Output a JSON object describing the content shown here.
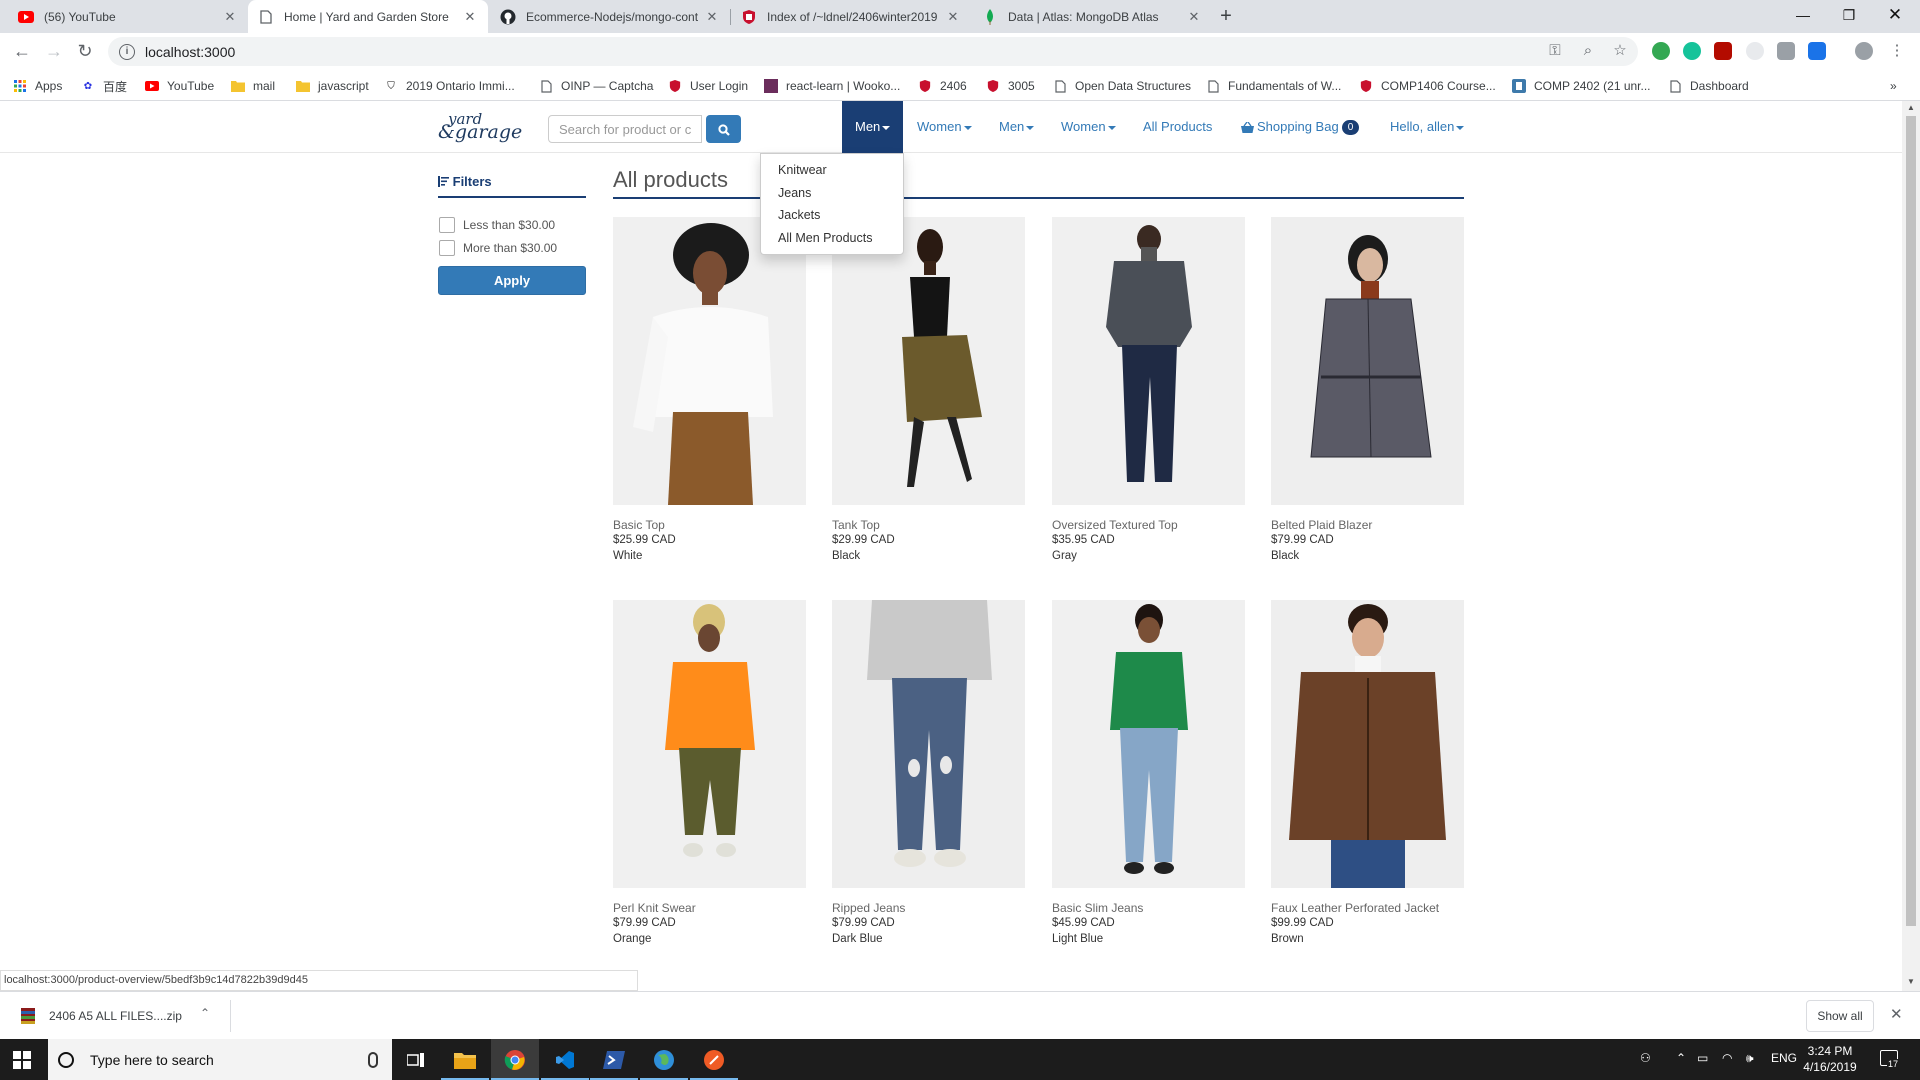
{
  "browser": {
    "tabs": [
      {
        "title": "(56) YouTube",
        "icon": "youtube-icon"
      },
      {
        "title": "Home | Yard and Garden Store",
        "icon": "page-icon",
        "active": true
      },
      {
        "title": "Ecommerce-Nodejs/mongo-cont",
        "icon": "github-icon"
      },
      {
        "title": "Index of /~ldnel/2406winter2019",
        "icon": "shield-icon"
      },
      {
        "title": "Data | Atlas: MongoDB Atlas",
        "icon": "leaf-icon"
      }
    ],
    "url": "localhost:3000",
    "bookmarks": [
      "Apps",
      "百度",
      "YouTube",
      "mail",
      "javascript",
      "2019 Ontario Immi...",
      "OINP — Captcha",
      "User Login",
      "react-learn | Wooko...",
      "2406",
      "3005",
      "Open Data Structures",
      "Fundamentals of W...",
      "COMP1406 Course...",
      "COMP 2402 (21 unr...",
      "Dashboard"
    ]
  },
  "site": {
    "logo_line1": "yard",
    "logo_line2": "&garage",
    "search_placeholder": "Search for product or c",
    "nav": {
      "men_open": "Men",
      "women1": "Women",
      "men2": "Men",
      "women2": "Women",
      "all_products": "All Products",
      "bag_label": "Shopping Bag",
      "bag_count": "0",
      "greeting": "Hello, allen"
    },
    "men_dropdown": [
      "Knitwear",
      "Jeans",
      "Jackets",
      "All Men Products"
    ],
    "filters": {
      "title": "Filters",
      "options": [
        "Less than $30.00",
        "More than $30.00"
      ],
      "apply": "Apply"
    },
    "section_title": "All products",
    "products": [
      {
        "name": "Basic Top",
        "price": "$25.99 CAD",
        "color": "White"
      },
      {
        "name": "Tank Top",
        "price": "$29.99 CAD",
        "color": "Black"
      },
      {
        "name": "Oversized Textured Top",
        "price": "$35.95 CAD",
        "color": "Gray"
      },
      {
        "name": "Belted Plaid Blazer",
        "price": "$79.99 CAD",
        "color": "Black"
      },
      {
        "name": "Perl Knit Swear",
        "price": "$79.99 CAD",
        "color": "Orange"
      },
      {
        "name": "Ripped Jeans",
        "price": "$79.99 CAD",
        "color": "Dark Blue"
      },
      {
        "name": "Basic Slim Jeans",
        "price": "$45.99 CAD",
        "color": "Light Blue"
      },
      {
        "name": "Faux Leather Perforated Jacket",
        "price": "$99.99 CAD",
        "color": "Brown"
      }
    ],
    "status_url": "localhost:3000/product-overview/5bedf3b9c14d7822b39d9d45"
  },
  "downloads": {
    "file": "2406 A5 ALL FILES....zip",
    "show_all": "Show all"
  },
  "taskbar": {
    "search_placeholder": "Type here to search",
    "lang": "ENG",
    "time": "3:24 PM",
    "date": "4/16/2019",
    "notifications": "17"
  },
  "colors": {
    "brand_navy": "#1a3e74",
    "link_blue": "#337ab7"
  }
}
